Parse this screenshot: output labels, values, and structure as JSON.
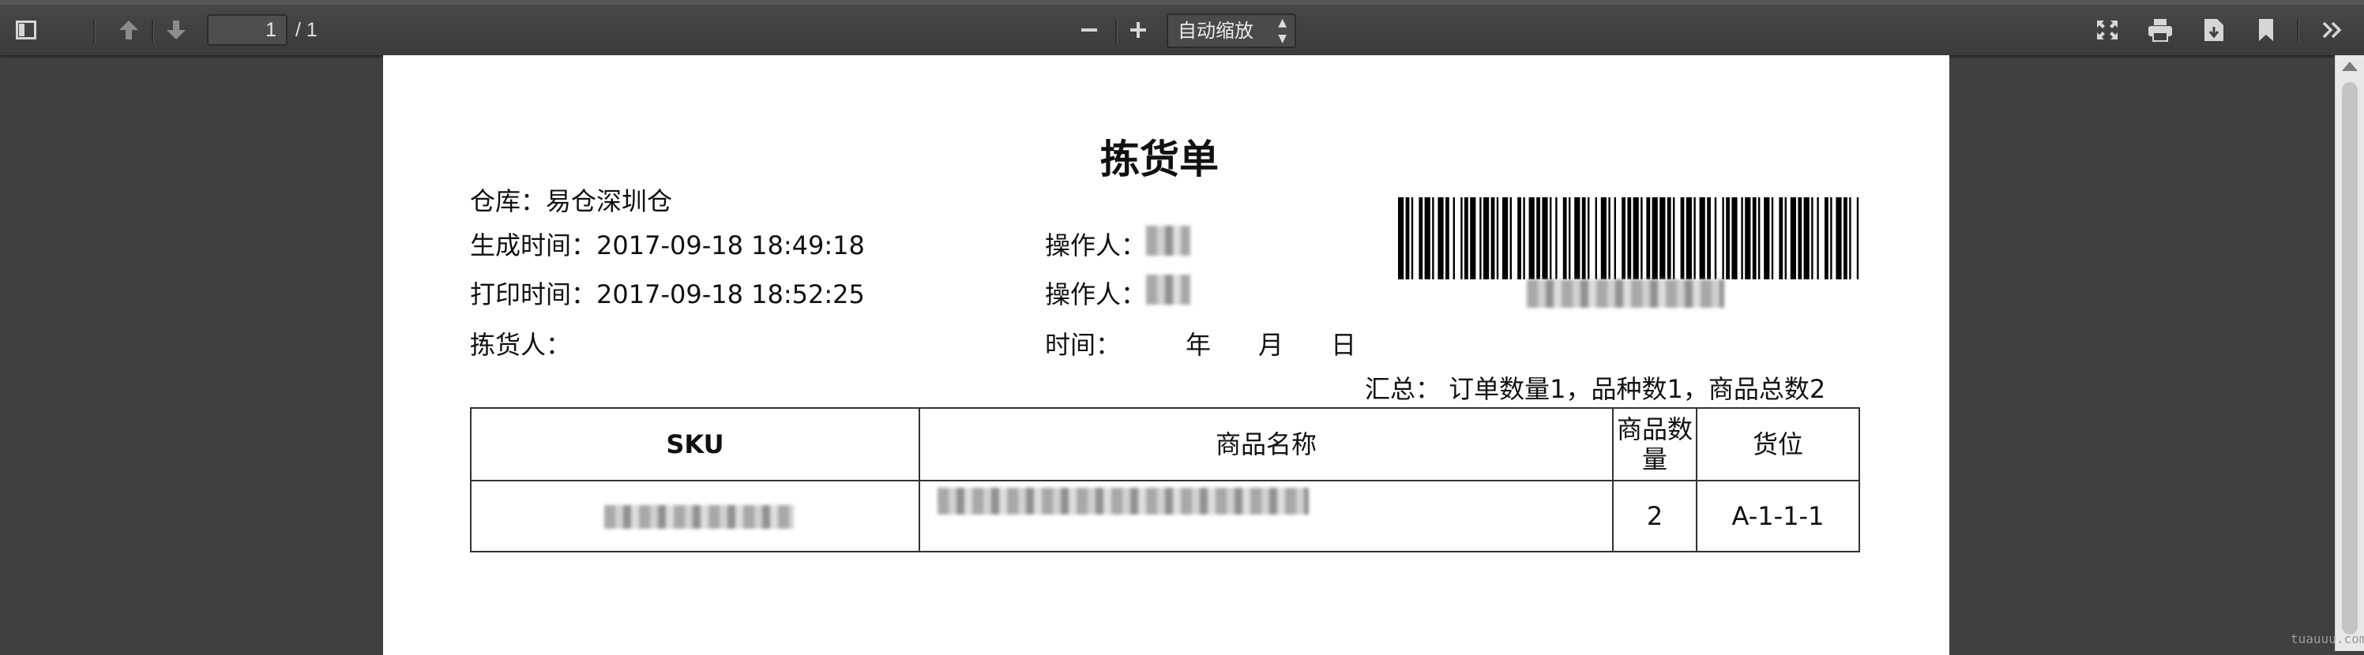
{
  "toolbar": {
    "sidebar_toggle_icon": "sidebar-toggle-icon",
    "prev_icon": "arrow-up-icon",
    "next_icon": "arrow-down-icon",
    "page_number": "1",
    "page_count": "/ 1",
    "zoom_out_icon": "minus-icon",
    "zoom_in_icon": "plus-icon",
    "zoom_value": "自动缩放",
    "presentation_icon": "fullscreen-icon",
    "print_icon": "print-icon",
    "download_icon": "download-icon",
    "bookmark_icon": "bookmark-icon",
    "tools_icon": "double-chevron-right-icon"
  },
  "document": {
    "title": "拣货单",
    "warehouse": "仓库：易仓深圳仓",
    "generated_time": "生成时间：2017-09-18 18:49:18",
    "operator_label_1": "操作人：",
    "print_time": "打印时间：2017-09-18 18:52:25",
    "operator_label_2": "操作人：",
    "picker_label": "拣货人：",
    "time_label": "时间：",
    "year": "年",
    "month": "月",
    "day": "日",
    "summary": "汇总： 订单数量1，品种数1，商品总数2",
    "table": {
      "headers": [
        "SKU",
        "商品名称",
        "商品数量",
        "货位"
      ],
      "rows": [
        {
          "sku": "",
          "name": "",
          "qty": "2",
          "location": "A-1-1-1"
        }
      ]
    }
  },
  "watermark": "tuauuu.com"
}
